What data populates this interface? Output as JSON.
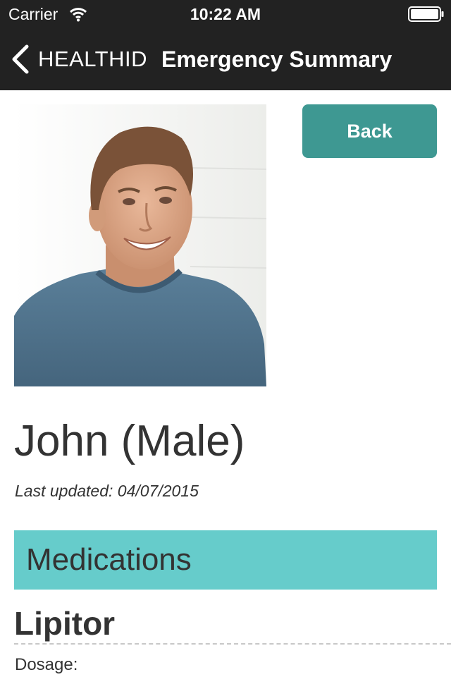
{
  "status_bar": {
    "carrier": "Carrier",
    "time": "10:22 AM",
    "wifi_icon": "wifi-icon",
    "battery_icon": "battery-full-icon"
  },
  "nav": {
    "back_label": "HEALTHID",
    "back_icon": "chevron-left-icon",
    "title": "Emergency Summary"
  },
  "profile": {
    "photo": "patient-photo",
    "back_button_label": "Back",
    "name": "John (Male)",
    "last_updated": "Last updated: 04/07/2015"
  },
  "medications": {
    "section_title": "Medications",
    "items": [
      {
        "name": "Lipitor",
        "dosage_label": "Dosage:"
      }
    ]
  },
  "colors": {
    "bar_background": "#222222",
    "button_accent": "#3e9892",
    "section_header": "#66cccb",
    "text": "#333333"
  }
}
